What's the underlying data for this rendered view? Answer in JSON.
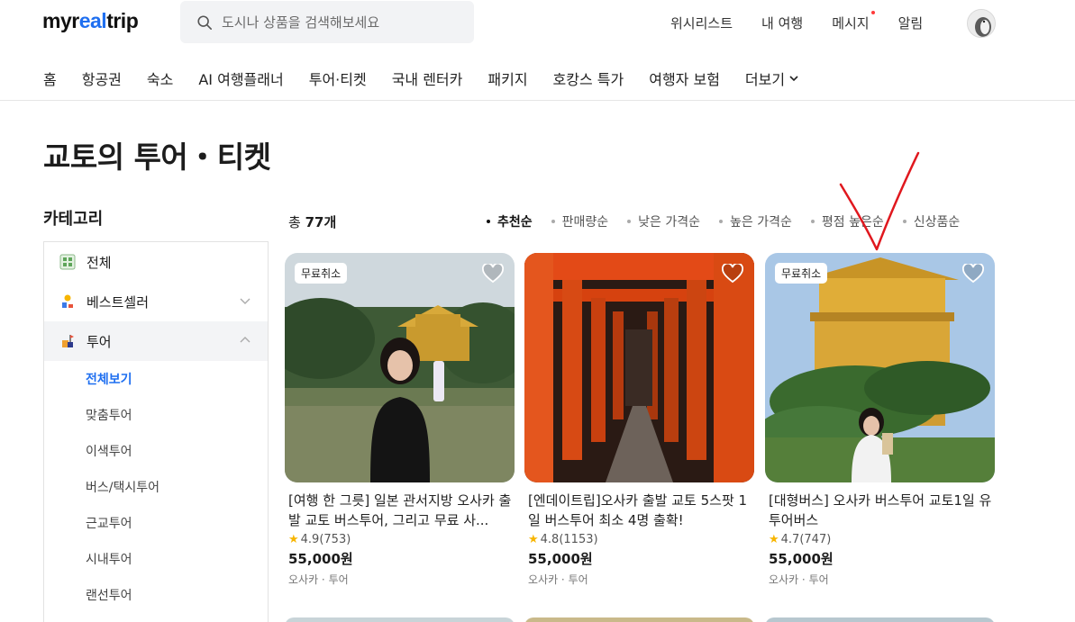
{
  "header": {
    "logo_main": "myr",
    "logo_accent": "eal",
    "logo_end": "trip",
    "search_placeholder": "도시나 상품을 검색해보세요",
    "links": [
      "위시리스트",
      "내 여행",
      "메시지",
      "알림"
    ]
  },
  "nav": [
    "홈",
    "항공권",
    "숙소",
    "AI 여행플래너",
    "투어·티켓",
    "국내 렌터카",
    "패키지",
    "호캉스 특가",
    "여행자 보험",
    "더보기"
  ],
  "page_title": "교토의 투어・티켓",
  "sidebar": {
    "title": "카테고리",
    "items": [
      {
        "label": "전체"
      },
      {
        "label": "베스트셀러"
      },
      {
        "label": "투어"
      }
    ],
    "sub_items": [
      "전체보기",
      "맞춤투어",
      "이색투어",
      "버스/택시투어",
      "근교투어",
      "시내투어",
      "랜선투어"
    ]
  },
  "results": {
    "total_prefix": "총 ",
    "total_count": "77개",
    "sorts": [
      "추천순",
      "판매량순",
      "낮은 가격순",
      "높은 가격순",
      "평점 높은순",
      "신상품순"
    ]
  },
  "cards": [
    {
      "badge": "무료취소",
      "name": "[여행 한 그릇] 일본 관서지방 오사카 출발 교토 버스투어, 그리고 무료 사...",
      "rating": "4.9",
      "reviews": "(753)",
      "price": "55,000원",
      "loc": "오사카 · 투어"
    },
    {
      "badge": "",
      "name": "[엔데이트립]오사카 출발 교토 5스팟 1일 버스투어 최소 4명 출확!",
      "rating": "4.8",
      "reviews": "(1153)",
      "price": "55,000원",
      "loc": "오사카 · 투어"
    },
    {
      "badge": "무료취소",
      "name": "[대형버스] 오사카 버스투어 교토1일 유투어버스",
      "rating": "4.7",
      "reviews": "(747)",
      "price": "55,000원",
      "loc": "오사카 · 투어"
    }
  ],
  "colors": {
    "accent": "#1f6ff0",
    "annotation": "#e0181e",
    "star": "#f7b500"
  }
}
